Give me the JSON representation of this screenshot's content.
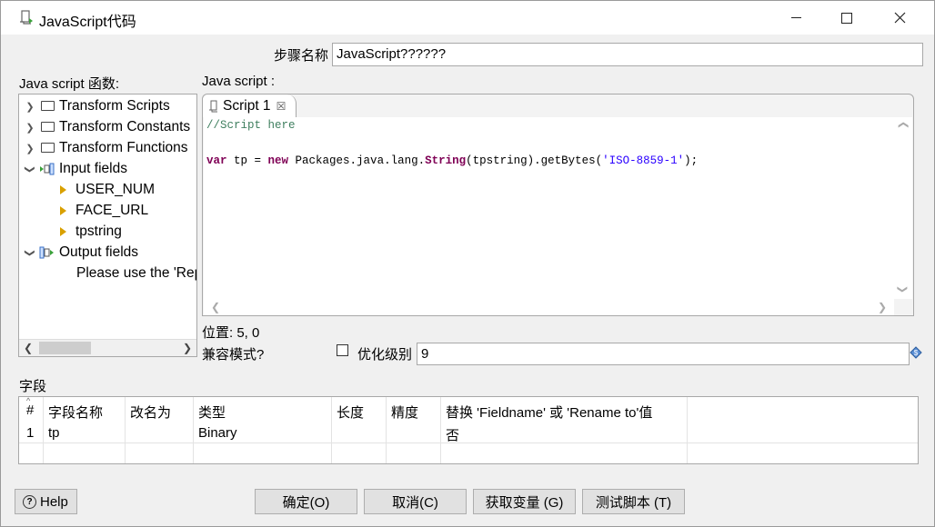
{
  "window": {
    "title": "JavaScript代码"
  },
  "step": {
    "label": "步骤名称",
    "value": "JavaScript??????"
  },
  "functions_label": "Java script 函数:",
  "script_label": "Java script :",
  "tree": {
    "items": [
      {
        "label": "Transform Scripts"
      },
      {
        "label": "Transform Constants"
      },
      {
        "label": "Transform Functions"
      },
      {
        "label": "Input fields"
      },
      {
        "label": "USER_NUM"
      },
      {
        "label": "FACE_URL"
      },
      {
        "label": "tpstring"
      },
      {
        "label": "Output fields"
      },
      {
        "label": "Please use the 'Replace value' option"
      }
    ]
  },
  "editor": {
    "tab_label": "Script 1",
    "tab_close": "☒",
    "line1": "//Script here",
    "line3": {
      "kw_var": "var",
      "t1": " tp = ",
      "kw_new": "new",
      "t2": " Packages.java.lang.",
      "type": "String",
      "t3": "(tpstring).getBytes(",
      "str": "'ISO-8859-1'",
      "t4": ");"
    }
  },
  "position": "位置: 5, 0",
  "compat": {
    "label": "兼容模式?",
    "opt_label": "优化级别",
    "opt_value": "9"
  },
  "fields": {
    "section_label": "字段",
    "headers": [
      "#",
      "字段名称",
      "改名为",
      "类型",
      "长度",
      "精度",
      "替换 'Fieldname' 或 'Rename to'值"
    ],
    "row": {
      "num": "1",
      "name": "tp",
      "rename": "",
      "type": "Binary",
      "length": "",
      "precision": "",
      "replace": "否"
    }
  },
  "buttons": {
    "help": "Help",
    "ok": "确定(O)",
    "cancel": "取消(C)",
    "vars": "获取变量 (G)",
    "test": "测试脚本 (T)"
  }
}
